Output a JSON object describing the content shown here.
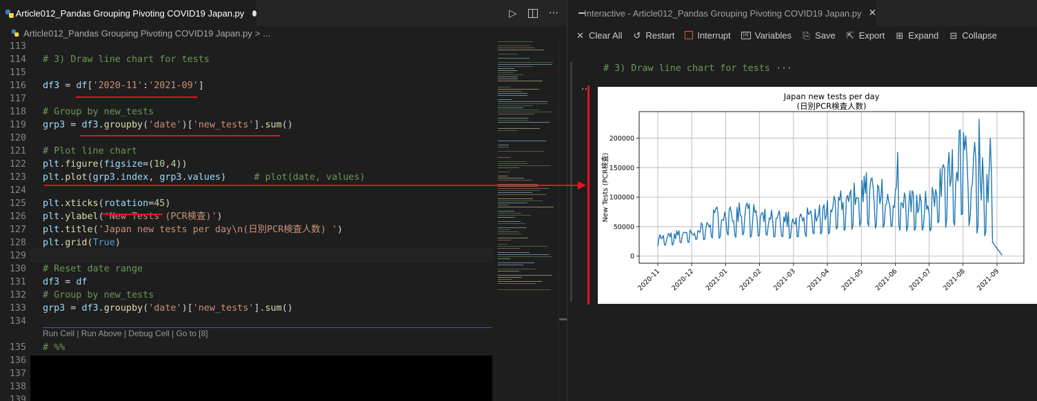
{
  "editor": {
    "tab_title": "Article012_Pandas Grouping Pivoting COVID19 Japan.py",
    "breadcrumb_file": "Article012_Pandas Grouping Pivoting COVID19 Japan.py",
    "breadcrumb_sep": ">",
    "breadcrumb_more": "...",
    "run_icon": "▷",
    "more_icon": "···",
    "codelens": "Run Cell | Run Above | Debug Cell | Go to [8]",
    "lines": [
      {
        "n": "113",
        "t": ""
      },
      {
        "n": "114",
        "t": "# 3) Draw line chart for tests"
      },
      {
        "n": "115",
        "t": ""
      },
      {
        "n": "116",
        "t": "df3 = df['2020-11':'2021-09']"
      },
      {
        "n": "117",
        "t": ""
      },
      {
        "n": "118",
        "t": "# Group by new_tests"
      },
      {
        "n": "119",
        "t": "grp3 = df3.groupby('date')['new_tests'].sum()"
      },
      {
        "n": "120",
        "t": ""
      },
      {
        "n": "121",
        "t": "# Plot line chart"
      },
      {
        "n": "122",
        "t": "plt.figure(figsize=(10,4))"
      },
      {
        "n": "123",
        "t": "plt.plot(grp3.index, grp3.values)     # plot(date, values)"
      },
      {
        "n": "124",
        "t": ""
      },
      {
        "n": "125",
        "t": "plt.xticks(rotation=45)"
      },
      {
        "n": "126",
        "t": "plt.ylabel('New Tests (PCR検査)')"
      },
      {
        "n": "127",
        "t": "plt.title('Japan new tests per day\\n(日別PCR検査人数) ')"
      },
      {
        "n": "128",
        "t": "plt.grid(True)"
      },
      {
        "n": "129",
        "t": ""
      },
      {
        "n": "130",
        "t": "# Reset date range"
      },
      {
        "n": "131",
        "t": "df3 = df"
      },
      {
        "n": "132",
        "t": "# Group by new_tests"
      },
      {
        "n": "133",
        "t": "grp3 = df3.groupby('date')['new_tests'].sum()"
      },
      {
        "n": "134",
        "t": ""
      },
      {
        "n": "135",
        "t": "# %%"
      },
      {
        "n": "136",
        "t": ""
      },
      {
        "n": "137",
        "t": ""
      },
      {
        "n": "138",
        "t": ""
      },
      {
        "n": "139",
        "t": ""
      }
    ]
  },
  "interactive": {
    "tab_title": "Interactive - Article012_Pandas Grouping Pivoting COVID19 Japan.py",
    "close_icon": "✕",
    "toolbar": [
      {
        "icon": "close-icon",
        "glyph": "✕",
        "label": "Clear All"
      },
      {
        "icon": "restart-icon",
        "glyph": "↺",
        "label": "Restart"
      },
      {
        "icon": "interrupt-icon",
        "glyph": "",
        "label": "Interrupt"
      },
      {
        "icon": "variables-icon",
        "glyph": "[x]",
        "label": "Variables"
      },
      {
        "icon": "save-icon",
        "glyph": "⎘",
        "label": "Save"
      },
      {
        "icon": "export-icon",
        "glyph": "⇱",
        "label": "Export"
      },
      {
        "icon": "expand-icon",
        "glyph": "⊞",
        "label": "Expand"
      },
      {
        "icon": "collapse-icon",
        "glyph": "⊟",
        "label": "Collapse"
      }
    ],
    "cell_input": "# 3) Draw line chart for tests",
    "cell_ellipsis": "···",
    "output_menu": "···"
  },
  "chart_data": {
    "type": "line",
    "title": "Japan new tests per day",
    "subtitle": "(日別PCR検査人数)",
    "xlabel": "",
    "ylabel": "New Tests (PCR検査)",
    "x_tick_labels": [
      "2020-11",
      "2020-12",
      "2021-01",
      "2021-02",
      "2021-03",
      "2021-04",
      "2021-05",
      "2021-06",
      "2021-07",
      "2021-08",
      "2021-09"
    ],
    "y_ticks": [
      0,
      50000,
      100000,
      150000,
      200000
    ],
    "ylim": [
      -12000,
      245000
    ],
    "grid": true,
    "line_color": "#1f77b4",
    "segments": [
      {
        "month": 0,
        "base": 13000,
        "peak": 38000
      },
      {
        "month": 1,
        "base": 22000,
        "peak": 48000
      },
      {
        "month": 2,
        "base": 28000,
        "peak": 100000
      },
      {
        "month": 3,
        "base": 25000,
        "peak": 85000
      },
      {
        "month": 4,
        "base": 26000,
        "peak": 78000
      },
      {
        "month": 5,
        "base": 33000,
        "peak": 95000
      },
      {
        "month": 6,
        "base": 40000,
        "peak": 148000
      },
      {
        "month": 7,
        "base": 40000,
        "peak": 120000
      },
      {
        "month": 8,
        "base": 35000,
        "peak": 110000
      },
      {
        "month": 9,
        "base": 45000,
        "peak": 230000
      },
      {
        "month": 10,
        "base": 0,
        "peak": 135000
      }
    ]
  }
}
